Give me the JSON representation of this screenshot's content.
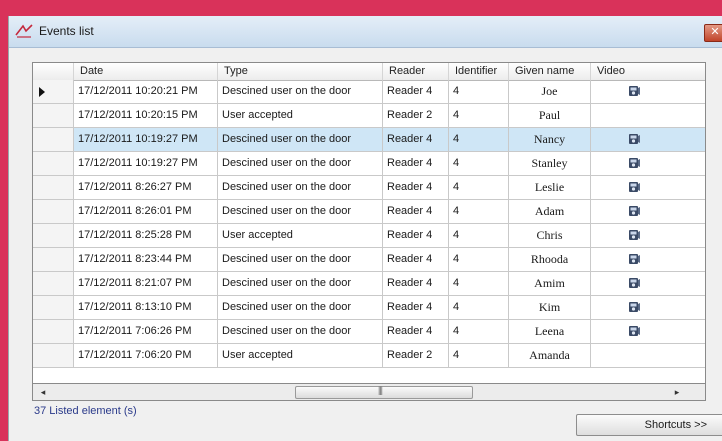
{
  "window": {
    "title": "Events list",
    "close_label": "✕"
  },
  "columns": [
    "Date",
    "Type",
    "Reader",
    "Identifier",
    "Given name",
    "Video"
  ],
  "rows": [
    {
      "date": "17/12/2011 10:20:21 PM",
      "type": "Descined user on the door",
      "reader": "Reader 4",
      "identifier": "4",
      "name": "Joe",
      "video": true,
      "current": true,
      "selected": false
    },
    {
      "date": "17/12/2011 10:20:15 PM",
      "type": "User accepted",
      "reader": "Reader 2",
      "identifier": "4",
      "name": "Paul",
      "video": false,
      "current": false,
      "selected": false
    },
    {
      "date": "17/12/2011 10:19:27 PM",
      "type": "Descined user on the door",
      "reader": "Reader 4",
      "identifier": "4",
      "name": "Nancy",
      "video": true,
      "current": false,
      "selected": true
    },
    {
      "date": "17/12/2011 10:19:27 PM",
      "type": "Descined user on the door",
      "reader": "Reader 4",
      "identifier": "4",
      "name": "Stanley",
      "video": true,
      "current": false,
      "selected": false
    },
    {
      "date": "17/12/2011 8:26:27 PM",
      "type": "Descined user on the door",
      "reader": "Reader 4",
      "identifier": "4",
      "name": "Leslie",
      "video": true,
      "current": false,
      "selected": false
    },
    {
      "date": "17/12/2011 8:26:01 PM",
      "type": "Descined user on the door",
      "reader": "Reader 4",
      "identifier": "4",
      "name": "Adam",
      "video": true,
      "current": false,
      "selected": false
    },
    {
      "date": "17/12/2011 8:25:28 PM",
      "type": "User accepted",
      "reader": "Reader 4",
      "identifier": "4",
      "name": "Chris",
      "video": true,
      "current": false,
      "selected": false
    },
    {
      "date": "17/12/2011 8:23:44 PM",
      "type": "Descined user on the door",
      "reader": "Reader 4",
      "identifier": "4",
      "name": "Rhooda",
      "video": true,
      "current": false,
      "selected": false
    },
    {
      "date": "17/12/2011 8:21:07 PM",
      "type": "Descined user on the door",
      "reader": "Reader 4",
      "identifier": "4",
      "name": "Amim",
      "video": true,
      "current": false,
      "selected": false
    },
    {
      "date": "17/12/2011 8:13:10 PM",
      "type": "Descined user on the door",
      "reader": "Reader 4",
      "identifier": "4",
      "name": "Kim",
      "video": true,
      "current": false,
      "selected": false
    },
    {
      "date": "17/12/2011 7:06:26 PM",
      "type": "Descined user on the door",
      "reader": "Reader 4",
      "identifier": "4",
      "name": "Leena",
      "video": true,
      "current": false,
      "selected": false
    },
    {
      "date": "17/12/2011 7:06:20 PM",
      "type": "User accepted",
      "reader": "Reader 2",
      "identifier": "4",
      "name": "Amanda",
      "video": false,
      "current": false,
      "selected": false
    }
  ],
  "scrollbar": {
    "left_arrow": "◂",
    "right_arrow": "▸",
    "grip": "|||"
  },
  "status": {
    "listed_text": "37 Listed element (s)"
  },
  "buttons": {
    "shortcuts_label": "Shortcuts >>"
  },
  "icons": {
    "app": "events-app-icon",
    "video": "video-camera-icon",
    "row_pointer": "row-pointer-icon"
  },
  "colors": {
    "background": "#d9325a",
    "selected_row": "#cfe6f6",
    "status_text": "#2a3a8a"
  }
}
